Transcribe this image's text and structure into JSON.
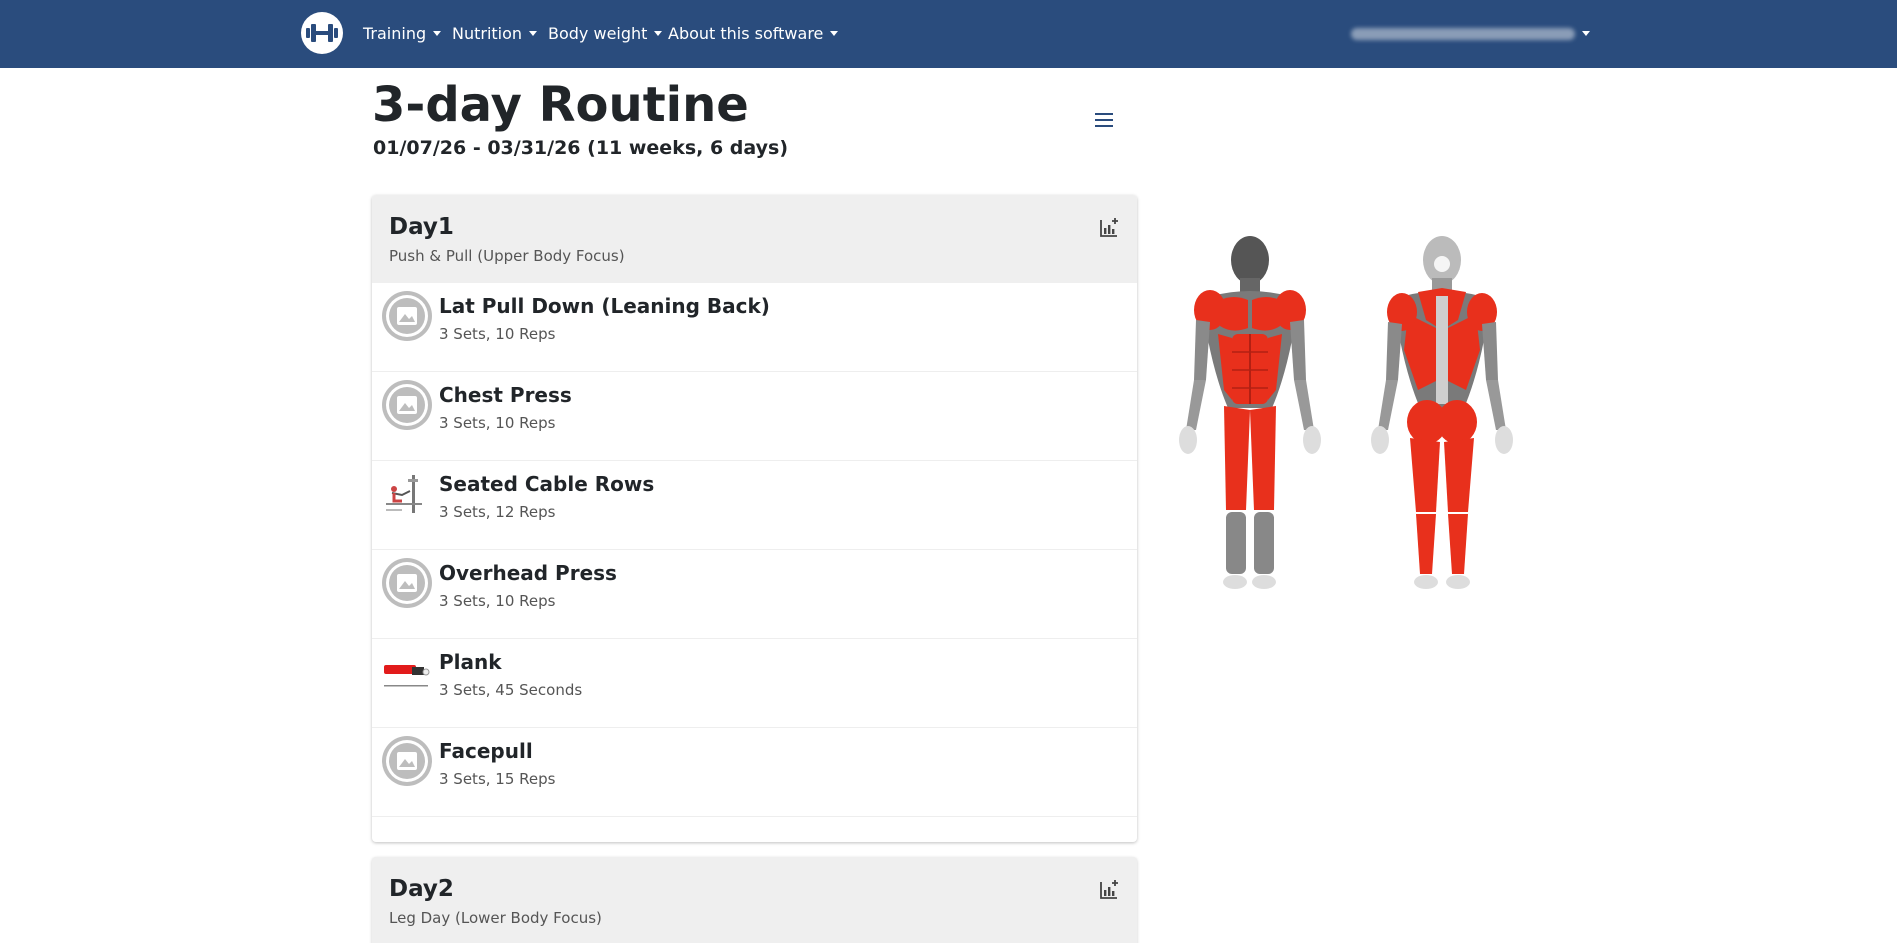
{
  "navbar": {
    "items": [
      {
        "label": "Training"
      },
      {
        "label": "Nutrition"
      },
      {
        "label": "Body weight"
      },
      {
        "label": "About this software"
      }
    ]
  },
  "routine": {
    "title": "3-day Routine",
    "subtitle": "01/07/26 - 03/31/26 (11 weeks, 6 days)"
  },
  "days": [
    {
      "name": "Day1",
      "description": "Push & Pull (Upper Body Focus)",
      "exercises": [
        {
          "name": "Lat Pull Down (Leaning Back)",
          "detail": "3 Sets, 10 Reps",
          "thumbnail": "image-placeholder-icon"
        },
        {
          "name": "Chest Press",
          "detail": "3 Sets, 10 Reps",
          "thumbnail": "image-placeholder-icon"
        },
        {
          "name": "Seated Cable Rows",
          "detail": "3 Sets, 12 Reps",
          "thumbnail": "exercise-image"
        },
        {
          "name": "Overhead Press",
          "detail": "3 Sets, 10 Reps",
          "thumbnail": "image-placeholder-icon"
        },
        {
          "name": "Plank",
          "detail": "3 Sets, 45 Seconds",
          "thumbnail": "exercise-image"
        },
        {
          "name": "Facepull",
          "detail": "3 Sets, 15 Reps",
          "thumbnail": "image-placeholder-icon"
        }
      ]
    },
    {
      "name": "Day2",
      "description": "Leg Day (Lower Body Focus)"
    }
  ],
  "colors": {
    "navbar": "#2a4c7d",
    "card_header": "#efefef",
    "muscle_highlight": "#e8301c"
  }
}
